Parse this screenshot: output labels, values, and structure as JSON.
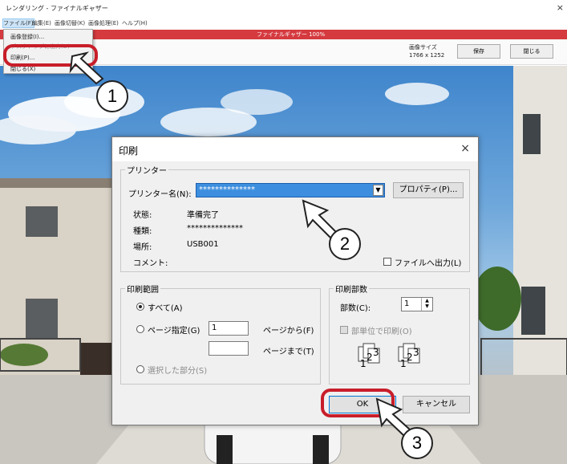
{
  "window": {
    "title": "レンダリング - ファイナルギャザー",
    "close": "×"
  },
  "menu": [
    "ファイル(F)",
    "編集(E)",
    "画像切替(K)",
    "画像処理(E)",
    "ヘルプ(H)"
  ],
  "file_menu": [
    "画像登録(I)...",
    "デスクトップに出力(D)",
    "印刷(P)...",
    "閉じる(X)"
  ],
  "progress_label": "ファイナルギャザー 100%",
  "image_size": {
    "label": "画像サイズ",
    "value": "1766 x 1252"
  },
  "toolbar": {
    "save": "保存",
    "close": "閉じる"
  },
  "callouts": [
    "1",
    "2",
    "3"
  ],
  "dialog": {
    "title": "印刷",
    "close": "×",
    "printer_group": "プリンター",
    "printer_name_label": "プリンター名(N):",
    "printer_name_value": "**************",
    "properties_button": "プロパティ(P)...",
    "status_label": "状態:",
    "status_value": "準備完了",
    "type_label": "種類:",
    "type_value": "**************",
    "location_label": "場所:",
    "location_value": "USB001",
    "comment_label": "コメント:",
    "print_to_file": "ファイルへ出力(L)",
    "range_group": "印刷範囲",
    "range_all": "すべて(A)",
    "range_pages": "ページ指定(G)",
    "page_from_value": "1",
    "page_from_label": "ページから(F)",
    "page_to_value": "",
    "page_to_label": "ページまで(T)",
    "range_selection": "選択した部分(S)",
    "copies_group": "印刷部数",
    "copies_label": "部数(C):",
    "copies_value": "1",
    "collate": "部単位で印刷(O)",
    "ok": "OK",
    "cancel": "キャンセル"
  }
}
